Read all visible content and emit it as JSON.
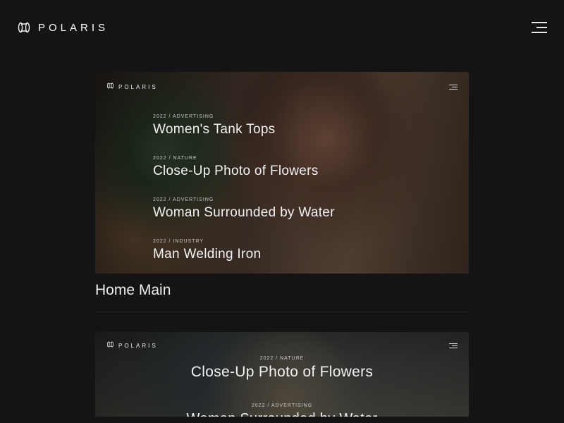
{
  "brand": {
    "name": "POLARIS"
  },
  "cards": [
    {
      "caption": "Home Main",
      "preview_brand": "POLARIS",
      "items": [
        {
          "meta": "2022 / ADVERTISING",
          "title": "Women's Tank Tops"
        },
        {
          "meta": "2022 / NATURE",
          "title": "Close-Up Photo of Flowers"
        },
        {
          "meta": "2022 / ADVERTISING",
          "title": "Woman Surrounded by Water"
        },
        {
          "meta": "2022 / INDUSTRY",
          "title": "Man Welding Iron"
        }
      ]
    },
    {
      "preview_brand": "POLARIS",
      "items": [
        {
          "meta": "2022 / NATURE",
          "title": "Close-Up Photo of Flowers"
        },
        {
          "meta": "2022 / ADVERTISING",
          "title": "Woman Surrounded by Water"
        }
      ]
    }
  ]
}
